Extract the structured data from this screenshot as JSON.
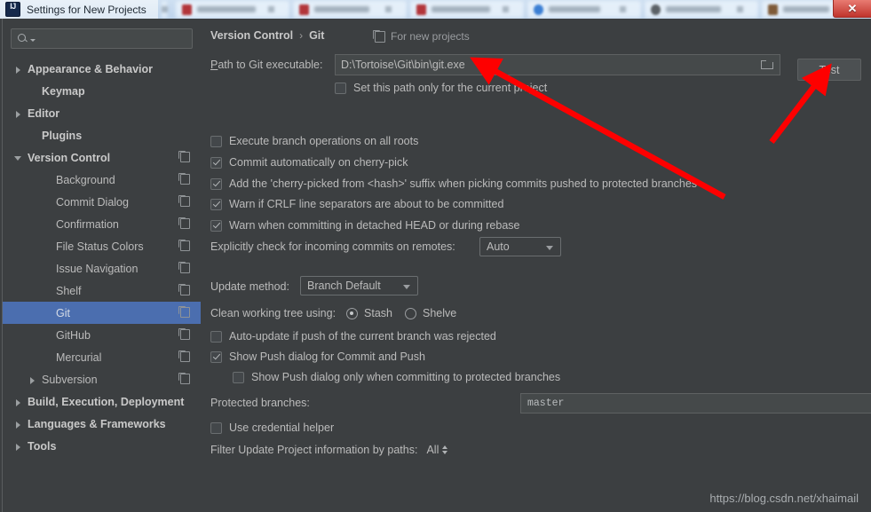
{
  "window": {
    "title": "Settings for New Projects",
    "logo_text": "IJ",
    "close_label": "✕"
  },
  "sidebar": {
    "search": {
      "value": "",
      "placeholder": ""
    },
    "items": [
      {
        "label": "Appearance & Behavior",
        "arrow": "right",
        "bold": true,
        "indent": 0,
        "copy": false,
        "selected": false
      },
      {
        "label": "Keymap",
        "arrow": "none",
        "bold": true,
        "indent": 1,
        "copy": false,
        "selected": false
      },
      {
        "label": "Editor",
        "arrow": "right",
        "bold": true,
        "indent": 0,
        "copy": false,
        "selected": false
      },
      {
        "label": "Plugins",
        "arrow": "none",
        "bold": true,
        "indent": 1,
        "copy": false,
        "selected": false
      },
      {
        "label": "Version Control",
        "arrow": "down",
        "bold": true,
        "indent": 0,
        "copy": true,
        "selected": false
      },
      {
        "label": "Background",
        "arrow": "none",
        "bold": false,
        "indent": 2,
        "copy": true,
        "selected": false
      },
      {
        "label": "Commit Dialog",
        "arrow": "none",
        "bold": false,
        "indent": 2,
        "copy": true,
        "selected": false
      },
      {
        "label": "Confirmation",
        "arrow": "none",
        "bold": false,
        "indent": 2,
        "copy": true,
        "selected": false
      },
      {
        "label": "File Status Colors",
        "arrow": "none",
        "bold": false,
        "indent": 2,
        "copy": true,
        "selected": false
      },
      {
        "label": "Issue Navigation",
        "arrow": "none",
        "bold": false,
        "indent": 2,
        "copy": true,
        "selected": false
      },
      {
        "label": "Shelf",
        "arrow": "none",
        "bold": false,
        "indent": 2,
        "copy": true,
        "selected": false
      },
      {
        "label": "Git",
        "arrow": "none",
        "bold": false,
        "indent": 2,
        "copy": true,
        "selected": true
      },
      {
        "label": "GitHub",
        "arrow": "none",
        "bold": false,
        "indent": 2,
        "copy": true,
        "selected": false
      },
      {
        "label": "Mercurial",
        "arrow": "none",
        "bold": false,
        "indent": 2,
        "copy": true,
        "selected": false
      },
      {
        "label": "Subversion",
        "arrow": "right",
        "bold": false,
        "indent": 1,
        "copy": true,
        "selected": false
      },
      {
        "label": "Build, Execution, Deployment",
        "arrow": "right",
        "bold": true,
        "indent": 0,
        "copy": false,
        "selected": false
      },
      {
        "label": "Languages & Frameworks",
        "arrow": "right",
        "bold": true,
        "indent": 0,
        "copy": false,
        "selected": false
      },
      {
        "label": "Tools",
        "arrow": "right",
        "bold": true,
        "indent": 0,
        "copy": false,
        "selected": false
      }
    ]
  },
  "content": {
    "breadcrumb": {
      "parent": "Version Control",
      "separator": "›",
      "current": "Git"
    },
    "for_new_projects": "For new projects",
    "path_label": "Path to Git executable:",
    "path_value": "D:\\Tortoise\\Git\\bin\\git.exe",
    "test_button": "Test",
    "set_path_only_current": "Set this path only for the current project",
    "checkboxes": [
      {
        "label": "Execute branch operations on all roots",
        "checked": false
      },
      {
        "label": "Commit automatically on cherry-pick",
        "checked": true
      },
      {
        "label": "Add the 'cherry-picked from <hash>' suffix when picking commits pushed to protected branches",
        "checked": true
      },
      {
        "label": "Warn if CRLF line separators are about to be committed",
        "checked": true
      },
      {
        "label": "Warn when committing in detached HEAD or during rebase",
        "checked": true
      }
    ],
    "explicit_check_label": "Explicitly check for incoming commits on remotes:",
    "explicit_check_value": "Auto",
    "update_method_label": "Update method:",
    "update_method_value": "Branch Default",
    "clean_tree_label": "Clean working tree using:",
    "clean_tree_stash": "Stash",
    "clean_tree_shelve": "Shelve",
    "clean_tree_selected": "Stash",
    "auto_update_label": "Auto-update if push of the current branch was rejected",
    "auto_update_checked": false,
    "show_push_label": "Show Push dialog for Commit and Push",
    "show_push_checked": true,
    "show_push_protected_label": "Show Push dialog only when committing to protected branches",
    "show_push_protected_checked": false,
    "protected_branches_label": "Protected branches:",
    "protected_branches_value": "master",
    "use_credential_label": "Use credential helper",
    "use_credential_checked": false,
    "filter_label": "Filter Update Project information by paths:",
    "filter_value": "All"
  },
  "watermark": "https://blog.csdn.net/xhaimail",
  "colors": {
    "selection_blue": "#4b6eaf",
    "panel_bg": "#3c3f41",
    "field_bg": "#45494a",
    "text": "#bbbbbb",
    "annotation_red": "#fe0000",
    "titlebar": "#e9f1f8"
  },
  "annotations": {
    "arrow_to_path_field": "red-arrow",
    "arrow_to_test_button": "red-arrow"
  }
}
